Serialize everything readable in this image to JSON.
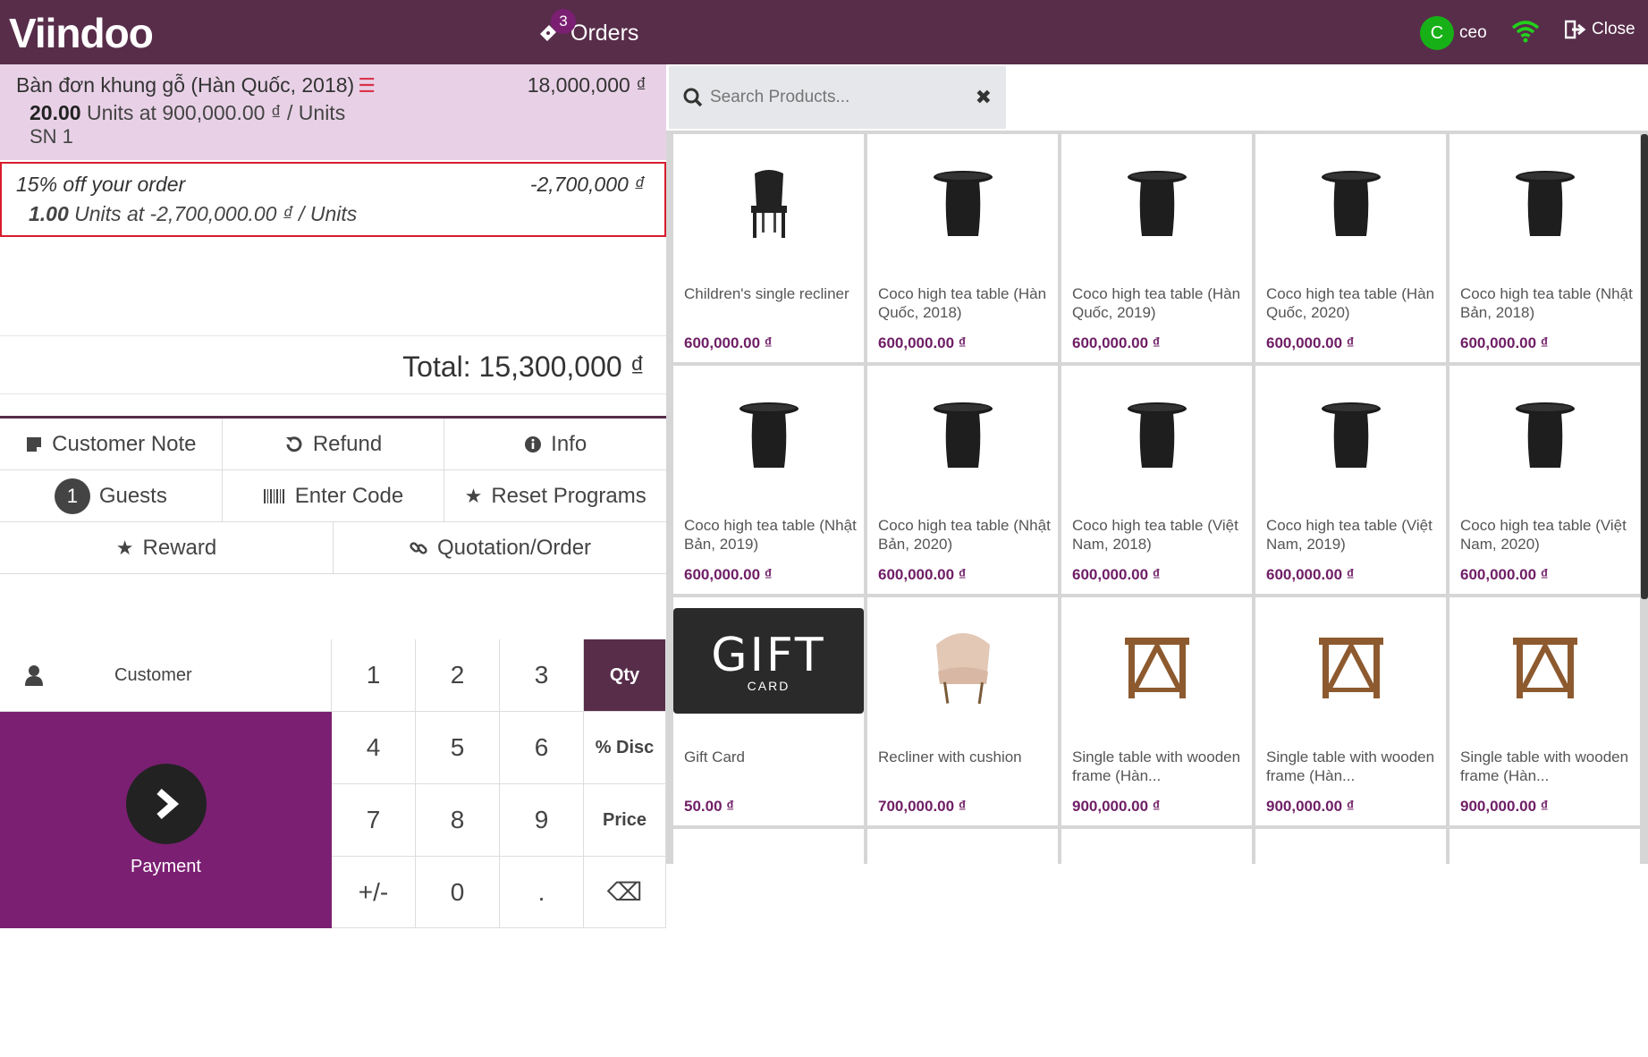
{
  "header": {
    "logo": "Viindoo",
    "orders_label": "Orders",
    "orders_count": "3",
    "user_initial": "C",
    "user_name": "ceo",
    "close_label": "Close"
  },
  "order": {
    "lines": [
      {
        "name": "Bàn đơn khung gỗ (Hàn Quốc, 2018)",
        "price": "18,000,000 ₫",
        "qty": "20.00",
        "unit_info": "Units at 900,000.00 ₫ / Units",
        "sn": "SN 1"
      },
      {
        "name": "15% off your order",
        "price": "-2,700,000 ₫",
        "qty": "1.00",
        "unit_info": "Units at -2,700,000.00 ₫ / Units"
      }
    ],
    "total": "Total: 15,300,000 ₫"
  },
  "controls": {
    "customer_note": "Customer Note",
    "refund": "Refund",
    "info": "Info",
    "guests_count": "1",
    "guests": "Guests",
    "enter_code": "Enter Code",
    "reset_programs": "Reset Programs",
    "reward": "Reward",
    "quotation_order": "Quotation/Order",
    "customer": "Customer",
    "payment": "Payment"
  },
  "numpad": {
    "keys": [
      "1",
      "2",
      "3",
      "Qty",
      "4",
      "5",
      "6",
      "% Disc",
      "7",
      "8",
      "9",
      "Price",
      "+/-",
      "0",
      ".",
      "⌫"
    ],
    "active_mode": "Qty"
  },
  "search": {
    "placeholder": "Search Products..."
  },
  "products": [
    {
      "name": "Children's single recliner",
      "price": "600,000.00 ₫",
      "icon": "chair-icon"
    },
    {
      "name": "Coco high tea table (Hàn Quốc, 2018)",
      "price": "600,000.00 ₫",
      "icon": "table-icon"
    },
    {
      "name": "Coco high tea table (Hàn Quốc, 2019)",
      "price": "600,000.00 ₫",
      "icon": "table-icon"
    },
    {
      "name": "Coco high tea table (Hàn Quốc, 2020)",
      "price": "600,000.00 ₫",
      "icon": "table-icon"
    },
    {
      "name": "Coco high tea table (Nhật Bản, 2018)",
      "price": "600,000.00 ₫",
      "icon": "table-icon"
    },
    {
      "name": "Coco high tea table (Nhật Bản, 2019)",
      "price": "600,000.00 ₫",
      "icon": "table-icon"
    },
    {
      "name": "Coco high tea table (Nhật Bản, 2020)",
      "price": "600,000.00 ₫",
      "icon": "table-icon"
    },
    {
      "name": "Coco high tea table (Việt Nam, 2018)",
      "price": "600,000.00 ₫",
      "icon": "table-icon"
    },
    {
      "name": "Coco high tea table (Việt Nam, 2019)",
      "price": "600,000.00 ₫",
      "icon": "table-icon"
    },
    {
      "name": "Coco high tea table (Việt Nam, 2020)",
      "price": "600,000.00 ₫",
      "icon": "table-icon"
    },
    {
      "name": "Gift Card",
      "price": "50.00 ₫",
      "icon": "gift-card-icon",
      "image_text": "GIFT",
      "image_subtext": "CARD"
    },
    {
      "name": "Recliner with cushion",
      "price": "700,000.00 ₫",
      "icon": "armchair-icon"
    },
    {
      "name": "Single table with wooden frame (Hàn...",
      "price": "900,000.00 ₫",
      "icon": "wooden-table-icon"
    },
    {
      "name": "Single table with wooden frame (Hàn...",
      "price": "900,000.00 ₫",
      "icon": "wooden-table-icon"
    },
    {
      "name": "Single table with wooden frame (Hàn...",
      "price": "900,000.00 ₫",
      "icon": "wooden-table-icon"
    }
  ],
  "colors": {
    "header_bg": "#582d4a",
    "accent": "#7b1f72",
    "selected_line_bg": "#e8d1e6",
    "reward_border": "#d81b2c",
    "price_text": "#6f1e66"
  }
}
